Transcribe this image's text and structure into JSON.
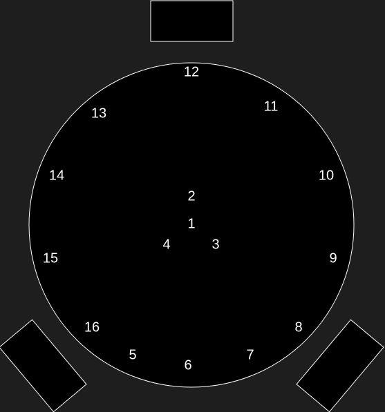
{
  "diagram": {
    "colors": {
      "background": "#1e1e1e",
      "fill": "#000000",
      "stroke": "#ffffff",
      "text": "#ffffff"
    },
    "labels": {
      "pos1": "1",
      "pos2": "2",
      "pos3": "3",
      "pos4": "4",
      "pos5": "5",
      "pos6": "6",
      "pos7": "7",
      "pos8": "8",
      "pos9": "9",
      "pos10": "10",
      "pos11": "11",
      "pos12": "12",
      "pos13": "13",
      "pos14": "14",
      "pos15": "15",
      "pos16": "16"
    }
  }
}
